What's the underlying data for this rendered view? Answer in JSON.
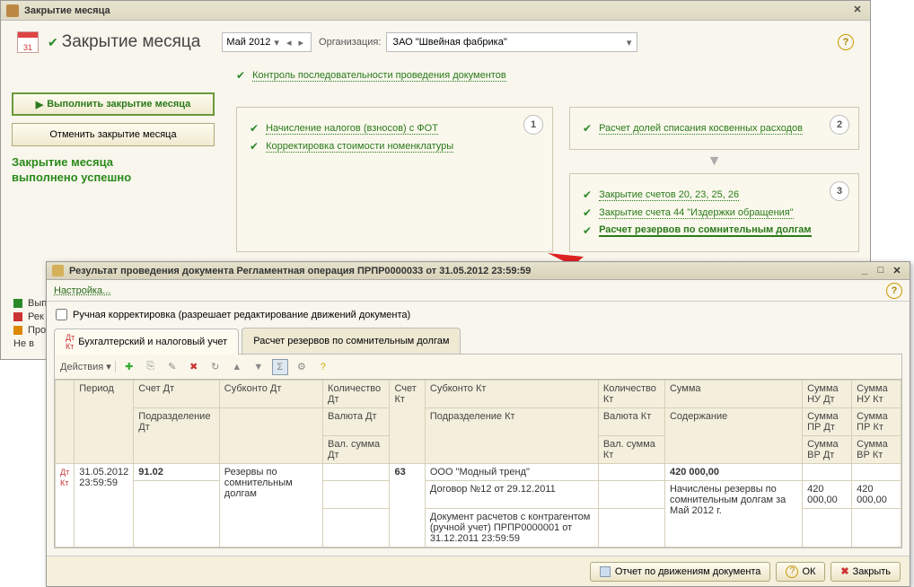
{
  "main": {
    "title": "Закрытие месяца",
    "pageTitle": "Закрытие месяца",
    "period": "Май 2012",
    "orgLabel": "Организация:",
    "org": "ЗАО \"Швейная фабрика\"",
    "calDay": "31",
    "btnExecute": "Выполнить закрытие месяца",
    "btnCancel": "Отменить закрытие месяца",
    "statusLine1": "Закрытие месяца",
    "statusLine2": "выполнено успешно",
    "topLink": "Контроль последовательности проведения документов",
    "step1": {
      "link1": "Начисление налогов (взносов) с ФОТ",
      "link2": "Корректировка стоимости номенклатуры"
    },
    "step2": {
      "link1": "Расчет долей списания косвенных расходов"
    },
    "step3": {
      "link1": "Закрытие счетов 20, 23, 25, 26",
      "link2": "Закрытие счета 44 \"Издержки обращения\"",
      "link3": "Расчет резервов по сомнительным долгам"
    },
    "legend": {
      "done": "Вып",
      "rec": "Рек",
      "req": "Про",
      "nv": "Не в"
    }
  },
  "ov": {
    "title": "Результат проведения документа Регламентная операция ПРПР0000033 от 31.05.2012 23:59:59",
    "settings": "Настройка...",
    "manualEdit": "Ручная корректировка (разрешает редактирование движений документа)",
    "tab1": "Бухгалтерский и налоговый учет",
    "tab2": "Расчет резервов по сомнительным долгам",
    "actions": "Действия",
    "headers": {
      "period": "Период",
      "acctDt": "Счет Дт",
      "subDt": "Субконто Дт",
      "qtyDt": "Количество Дт",
      "acctKt": "Счет Кт",
      "subKt": "Субконто Кт",
      "qtyKt": "Количество Кт",
      "sum": "Сумма",
      "sumNuDt": "Сумма НУ Дт",
      "sumNuKt": "Сумма НУ Кт",
      "podrDt": "Подразделение Дт",
      "valDt": "Валюта Дт",
      "podrKt": "Подразделение Кт",
      "valKt": "Валюта Кт",
      "content": "Содержание",
      "sumPrDt": "Сумма ПР Дт",
      "sumPrKt": "Сумма ПР Кт",
      "valSumDt": "Вал. сумма Дт",
      "valSumKt": "Вал. сумма Кт",
      "sumVrDt": "Сумма ВР Дт",
      "sumVrKt": "Сумма ВР Кт"
    },
    "row": {
      "date": "31.05.2012",
      "time": "23:59:59",
      "acctDt": "91.02",
      "acctKt": "63",
      "subDt": "Резервы по сомнительным долгам",
      "subKt1": "ООО \"Модный тренд\"",
      "subKt2": "Договор №12 от 29.12.2011",
      "subKt3": "Документ расчетов с контрагентом (ручной учет) ПРПР0000001 от 31.12.2011 23:59:59",
      "sum": "420 000,00",
      "content": "Начислены резервы по сомнительным долгам за Май 2012 г.",
      "sumNuDt": "420 000,00",
      "sumNuKt": "420 000,00"
    },
    "footer": {
      "report": "Отчет по движениям документа",
      "ok": "ОК",
      "close": "Закрыть"
    }
  }
}
